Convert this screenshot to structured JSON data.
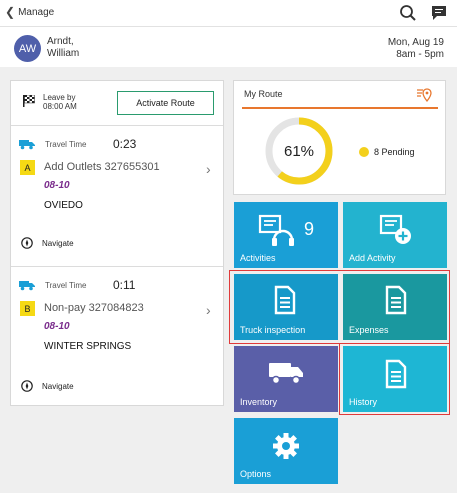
{
  "topbar": {
    "back_label": "Manage",
    "icons": [
      "chevron-left-icon",
      "search-icon",
      "chat-icon"
    ]
  },
  "user": {
    "initials": "AW",
    "name_line1": "Arndt,",
    "name_line2": "William",
    "date": "Mon, Aug 19",
    "hours": "8am - 5pm",
    "avatar_color": "#4f5faa"
  },
  "departure": {
    "leave_line1": "Leave by",
    "leave_line2": "08:00 AM",
    "activate_label": "Activate Route"
  },
  "stops": [
    {
      "travel_label": "Travel Time",
      "travel_time": "0:23",
      "badge": "A",
      "name": "Add Outlets 327655301",
      "date": "08-10",
      "city": "OVIEDO",
      "navigate_label": "Navigate"
    },
    {
      "travel_label": "Travel Time",
      "travel_time": "0:11",
      "badge": "B",
      "name": "Non-pay 327084823",
      "date": "08-10",
      "city": "WINTER SPRINGS",
      "navigate_label": "Navigate"
    }
  ],
  "route": {
    "title": "My Route",
    "progress_percent": 61,
    "progress_label": "61%",
    "pending_label": "8 Pending",
    "ring_color": "#f3d01c",
    "ring_track_color": "#e4e4e4",
    "accent_rule_color": "#e8772e"
  },
  "tiles": {
    "activities": {
      "label": "Activities",
      "count": "9",
      "color": "#1a9fd6",
      "icon": "activities-headset-icon"
    },
    "add_activity": {
      "label": "Add Activity",
      "color": "#23b3cf",
      "icon": "add-activity-icon"
    },
    "truck_inspection": {
      "label": "Truck inspection",
      "color": "#1699c9",
      "icon": "document-icon"
    },
    "expenses": {
      "label": "Expenses",
      "color": "#1a989f",
      "icon": "document-icon"
    },
    "inventory": {
      "label": "Inventory",
      "color": "#5a5fa8",
      "icon": "truck-icon"
    },
    "history": {
      "label": "History",
      "color": "#1eb6d4",
      "icon": "document-icon"
    },
    "options": {
      "label": "Options",
      "color": "#1a9fd6",
      "icon": "gear-icon"
    }
  },
  "colors": {
    "stop_date": "#7a2c8c",
    "badge": "#f5d914",
    "activate_border": "#2a9b6e",
    "highlight_border": "#e03a3a"
  }
}
